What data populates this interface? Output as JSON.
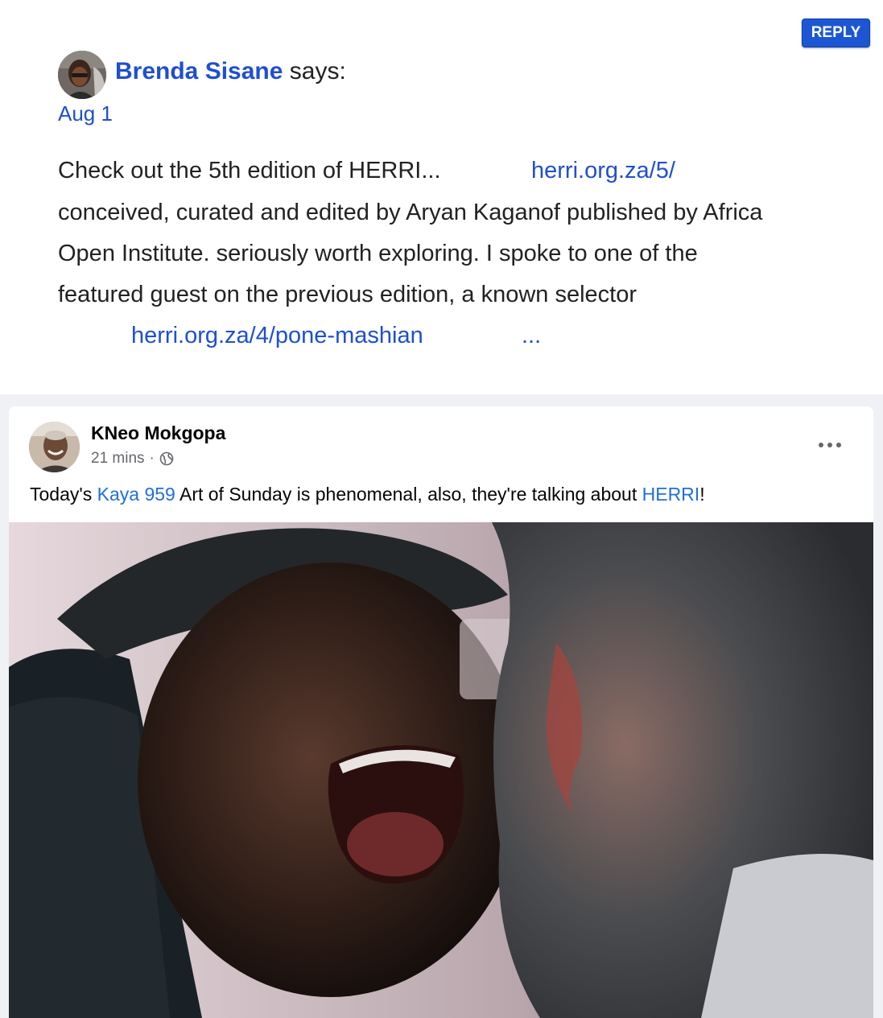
{
  "comment": {
    "reply_label": "REPLY",
    "author": "Brenda Sisane",
    "says": "says:",
    "date": "Aug 1",
    "line1_text": "Check out the 5th edition of HERRI...",
    "line1_link": "herri.org.za/5/",
    "line2": "conceived, curated and edited by Aryan Kaganof published by Africa",
    "line3": "Open Institute. seriously worth exploring. I spoke to one of the",
    "line4": "featured guest on the previous edition, a known selector",
    "line5_link": "herri.org.za/4/pone-mashian",
    "ellipsis": "..."
  },
  "post": {
    "author": "KNeo Mokgopa",
    "time": "21 mins",
    "separator": "·",
    "privacy_icon": "globe-icon",
    "more_icon": "more-horizontal-icon",
    "text_before": "Today's ",
    "link1": "Kaya 959",
    "text_middle": " Art of Sunday is phenomenal, also, they're talking about ",
    "link2": "HERRI",
    "text_after": "!"
  },
  "colors": {
    "page_bg": "#eff1f4",
    "reply_button": "#1c56d3",
    "comment_link": "#1f4fd0",
    "post_link": "#216fdb",
    "meta_text": "#65676b"
  }
}
